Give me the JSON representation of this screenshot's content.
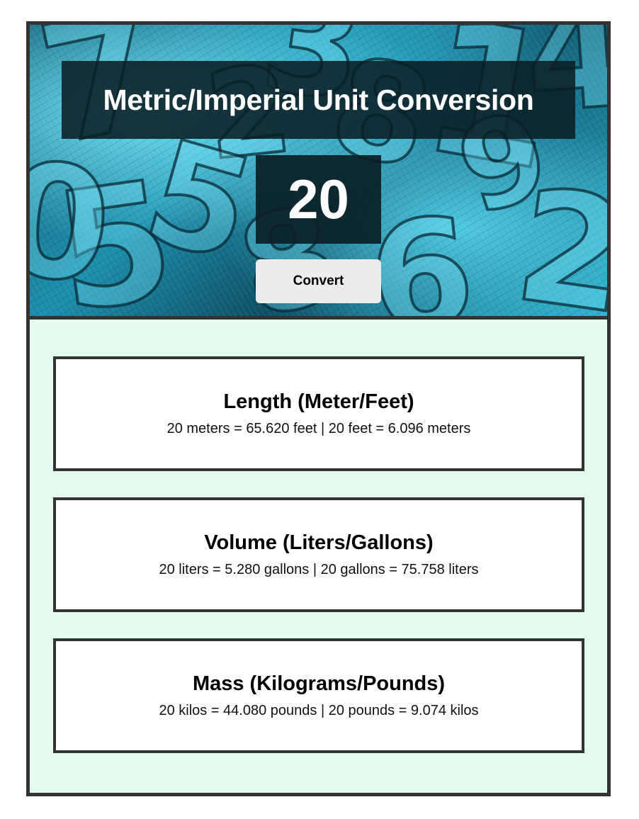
{
  "header": {
    "title": "Metric/Imperial Unit Conversion",
    "input_value": "20",
    "convert_label": "Convert",
    "background_digits": [
      "7",
      "3",
      "2",
      "8",
      "1",
      "4",
      "9",
      "5",
      "0",
      "6",
      "2",
      "5",
      "8"
    ]
  },
  "conversions": [
    {
      "title": "Length (Meter/Feet)",
      "text": "20 meters = 65.620 feet | 20 feet = 6.096 meters"
    },
    {
      "title": "Volume (Liters/Gallons)",
      "text": "20 liters = 5.280 gallons | 20 gallons = 75.758 liters"
    },
    {
      "title": "Mass (Kilograms/Pounds)",
      "text": "20 kilos = 44.080 pounds | 20 pounds = 9.074 kilos"
    }
  ],
  "colors": {
    "frame_border": "#333333",
    "results_background": "#e4fbf0",
    "overlay": "#0a1e24",
    "button_background": "#ececec"
  }
}
